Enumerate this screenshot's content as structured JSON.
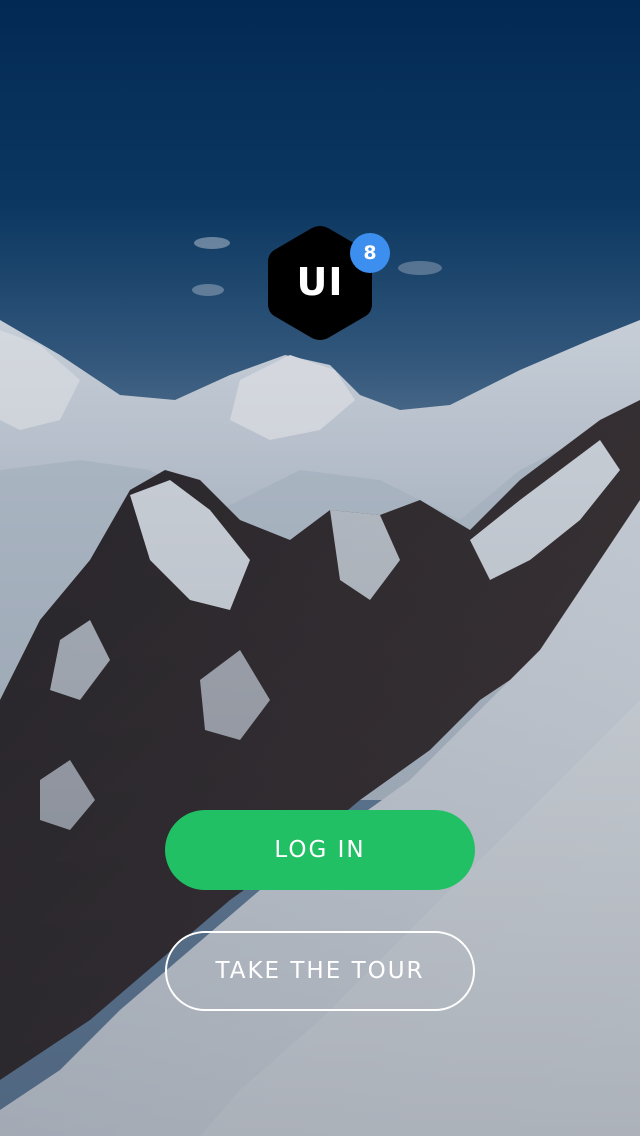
{
  "background": {
    "description_icon": "mountain-landscape-photo",
    "sky_top_color": "#022a55",
    "sky_bottom_color": "#4a6f92",
    "snow_color": "#e9eef4",
    "rock_color": "#3a3232"
  },
  "logo": {
    "text": "UI",
    "badge": "8",
    "hex_color": "#000000",
    "badge_color": "#3d8fef"
  },
  "actions": {
    "login_label": "LOG IN",
    "tour_label": "TAKE THE TOUR",
    "login_color": "#22c065"
  }
}
